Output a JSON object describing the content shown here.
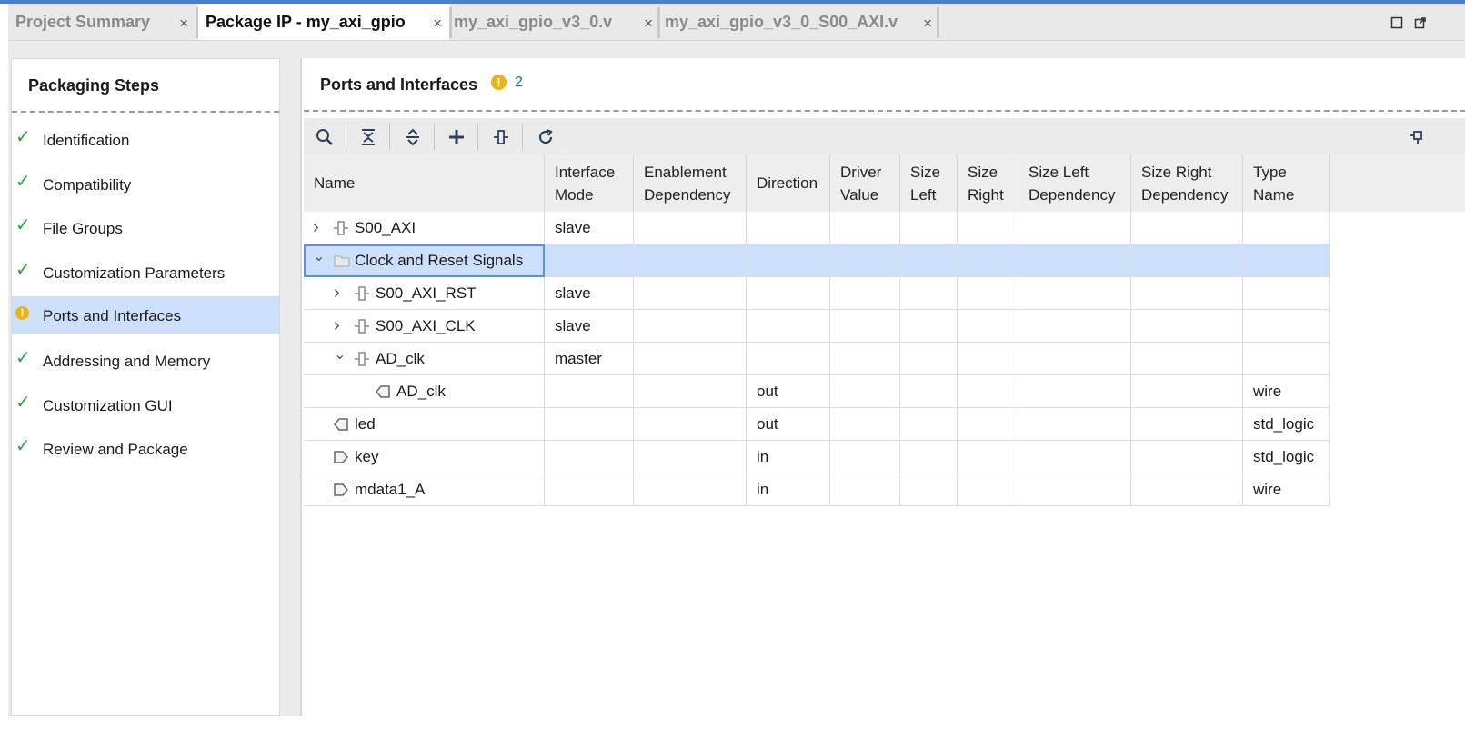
{
  "tabs": [
    {
      "label": "Project Summary",
      "active": false
    },
    {
      "label": "Package IP - my_axi_gpio",
      "active": true
    },
    {
      "label": "my_axi_gpio_v3_0.v",
      "active": false
    },
    {
      "label": "my_axi_gpio_v3_0_S00_AXI.v",
      "active": false
    }
  ],
  "tab_close_glyph": "×",
  "window_controls": {
    "restore_icon": "restore-icon",
    "float_icon": "float-icon"
  },
  "packaging_steps": {
    "title": "Packaging Steps",
    "items": [
      {
        "label": "Identification",
        "status": "done"
      },
      {
        "label": "Compatibility",
        "status": "done"
      },
      {
        "label": "File Groups",
        "status": "done"
      },
      {
        "label": "Customization Parameters",
        "status": "done"
      },
      {
        "label": "Ports and Interfaces",
        "status": "warning"
      },
      {
        "label": "Addressing and Memory",
        "status": "done"
      },
      {
        "label": "Customization GUI",
        "status": "done"
      },
      {
        "label": "Review and Package",
        "status": "done"
      }
    ],
    "check_glyph": "✓",
    "warn_glyph": "!"
  },
  "ports": {
    "title": "Ports and Interfaces",
    "warning_glyph": "!",
    "warning_count": "2",
    "toolbar": [
      "search-icon",
      "collapse-all-icon",
      "expand-all-icon",
      "add-icon",
      "interface-icon",
      "refresh-icon"
    ],
    "columns": [
      "Name",
      "Interface\nMode",
      "Enablement\nDependency",
      "Direction",
      "Driver\nValue",
      "Size\nLeft",
      "Size\nRight",
      "Size Left\nDependency",
      "Size Right\nDependency",
      "Type\nName"
    ],
    "rows": [
      {
        "name": "S00_AXI",
        "mode": "slave",
        "direction": "",
        "type": "",
        "icon": "bus-interface-icon",
        "expander": "›"
      },
      {
        "name": "Clock and Reset Signals",
        "mode": "",
        "direction": "",
        "type": "",
        "icon": "folder-icon",
        "expander": "⌄"
      },
      {
        "name": "S00_AXI_RST",
        "mode": "slave",
        "direction": "",
        "type": "",
        "icon": "bus-interface-icon",
        "expander": "›"
      },
      {
        "name": "S00_AXI_CLK",
        "mode": "slave",
        "direction": "",
        "type": "",
        "icon": "bus-interface-icon",
        "expander": "›"
      },
      {
        "name": "AD_clk",
        "mode": "master",
        "direction": "",
        "type": "",
        "icon": "bus-interface-icon",
        "expander": "⌄"
      },
      {
        "name": "AD_clk",
        "mode": "",
        "direction": "out",
        "type": "wire",
        "icon": "output-port-icon",
        "expander": ""
      },
      {
        "name": "led",
        "mode": "",
        "direction": "out",
        "type": "std_logic",
        "icon": "output-port-icon",
        "expander": ""
      },
      {
        "name": "key",
        "mode": "",
        "direction": "in",
        "type": "std_logic",
        "icon": "input-port-icon",
        "expander": ""
      },
      {
        "name": "mdata1_A",
        "mode": "",
        "direction": "in",
        "type": "wire",
        "icon": "input-port-icon",
        "expander": ""
      }
    ]
  },
  "colors": {
    "accent": "#4a7fd0",
    "selection": "#cde0fb",
    "check": "#2ea043",
    "warning": "#e8b514",
    "link": "#1a5fd0"
  }
}
